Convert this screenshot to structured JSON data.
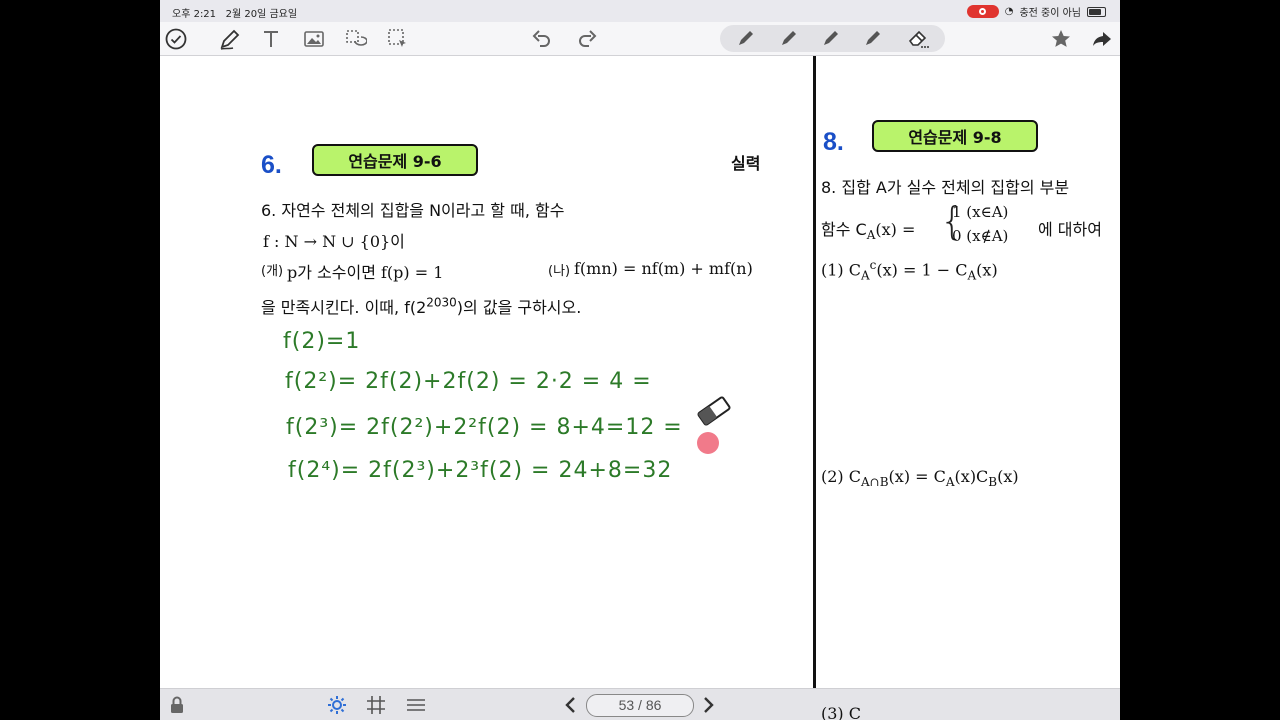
{
  "status": {
    "time": "오후 2:21",
    "date": "2월 20일 금요일",
    "charging": "충전 중이 아님"
  },
  "toolbar": {
    "icons": [
      "checkmark-icon",
      "pen-icon",
      "text-icon",
      "image-icon",
      "lasso-icon",
      "selection-icon",
      "undo-icon",
      "redo-icon",
      "pen-tool-icon",
      "eraser-icon",
      "star-icon",
      "share-icon"
    ]
  },
  "left": {
    "problem_number": "6.",
    "badge": "연습문제 9-6",
    "level": "실력",
    "line1": "6. 자연수 전체의 집합을 N이라고 할 때, 함수",
    "line2": "f : N → N ∪ {0}이",
    "cond_a_label": "(개)",
    "cond_a": "p가 소수이면 f(p) = 1",
    "cond_b_label": "(나)",
    "cond_b": "f(mn) = nf(m) + mf(n)",
    "line4_pre": "을 만족시킨다. 이때, f(2",
    "line4_exp": "2030",
    "line4_post": ")의 값을 구하시오.",
    "hand1": "f(2)=1",
    "hand2": "f(2²)= 2f(2)+2f(2) = 2·2 = 4 =",
    "hand3": "f(2³)= 2f(2²)+2²f(2) = 8+4=12 =",
    "hand4": "f(2⁴)= 2f(2³)+2³f(2) = 24+8=32"
  },
  "right": {
    "problem_number": "8.",
    "badge": "연습문제 9-8",
    "line1": "8. 집합 A가 실수 전체의 집합의 부분",
    "line2_pre": "함수 C",
    "line2_sub": "A",
    "line2_mid": "(x) =",
    "case1": "1 (x∈A)",
    "case2": "0 (x∉A)",
    "line2_post": "에 대하여",
    "item1": "(1) C",
    "item1_sub": "A",
    "item1_sup": "c",
    "item1_rest": "(x) = 1 − C",
    "item1_sub2": "A",
    "item1_end": "(x)",
    "item2": "(2) C",
    "item2_sub": "A∩B",
    "item2_rest": "(x) = C",
    "item2_sub2": "A",
    "item2_mid": "(x)C",
    "item2_sub3": "B",
    "item2_end": "(x)",
    "item3": "(3) C"
  },
  "bottom": {
    "page_counter": "53 / 86"
  }
}
